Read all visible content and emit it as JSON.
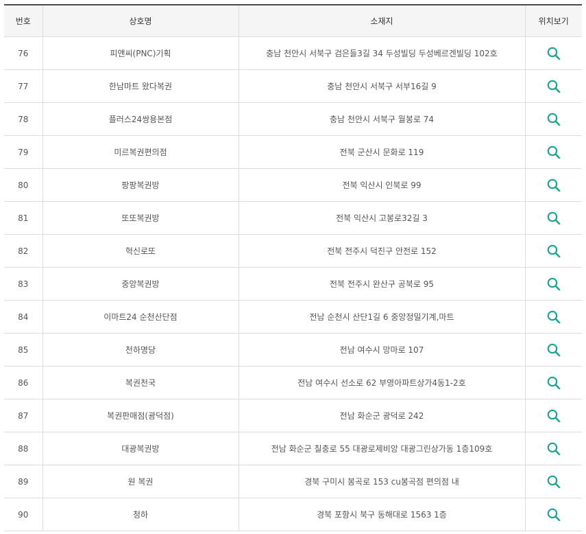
{
  "table": {
    "headers": {
      "no": "번호",
      "name": "상호명",
      "address": "소재지",
      "map": "위치보기"
    },
    "rows": [
      {
        "no": "76",
        "name": "피앤씨(PNC)기획",
        "address": "충남 천안시 서북구 검은들3길 34 두성빌딩 두성베르겐빌딩 102호"
      },
      {
        "no": "77",
        "name": "한남마트 왔다복권",
        "address": "충남 천안시 서북구 서부16길 9"
      },
      {
        "no": "78",
        "name": "플러스24쌍용본점",
        "address": "충남 천안시 서북구 월봉로 74"
      },
      {
        "no": "79",
        "name": "미르복권편의점",
        "address": "전북 군산시 문화로 119"
      },
      {
        "no": "80",
        "name": "팡팡복권방",
        "address": "전북 익산시 인북로 99"
      },
      {
        "no": "81",
        "name": "또또복권방",
        "address": "전북 익산시 고봉로32길 3"
      },
      {
        "no": "82",
        "name": "혁신로또",
        "address": "전북 전주시 덕진구 안전로 152"
      },
      {
        "no": "83",
        "name": "중앙복권방",
        "address": "전북 전주시 완산구 공북로 95"
      },
      {
        "no": "84",
        "name": "이마트24 순천산단점",
        "address": "전남 순천시 산단1길 6 중앙정밀기계,마트"
      },
      {
        "no": "85",
        "name": "천하명당",
        "address": "전남 여수시 망마로 107"
      },
      {
        "no": "86",
        "name": "복권천국",
        "address": "전남 여수시 선소로 62 부영아파트상가4동1-2호"
      },
      {
        "no": "87",
        "name": "복권판매점(광덕점)",
        "address": "전남 화순군 광덕로 242"
      },
      {
        "no": "88",
        "name": "대광복권방",
        "address": "전남 화순군 칠충로 55 대광로제비앙 대광그린상가동 1층109호"
      },
      {
        "no": "89",
        "name": "원 복권",
        "address": "경북 구미시 봉곡로 153 cu봉곡점 편의점 내"
      },
      {
        "no": "90",
        "name": "청하",
        "address": "경북 포항시 북구 동해대로 1563 1층"
      }
    ]
  },
  "icons": {
    "map": "search-icon"
  },
  "colors": {
    "accent": "#1aa39a",
    "header_bg": "#f5f5f5",
    "border": "#dcdcdc",
    "top_border": "#4a4a4a"
  }
}
